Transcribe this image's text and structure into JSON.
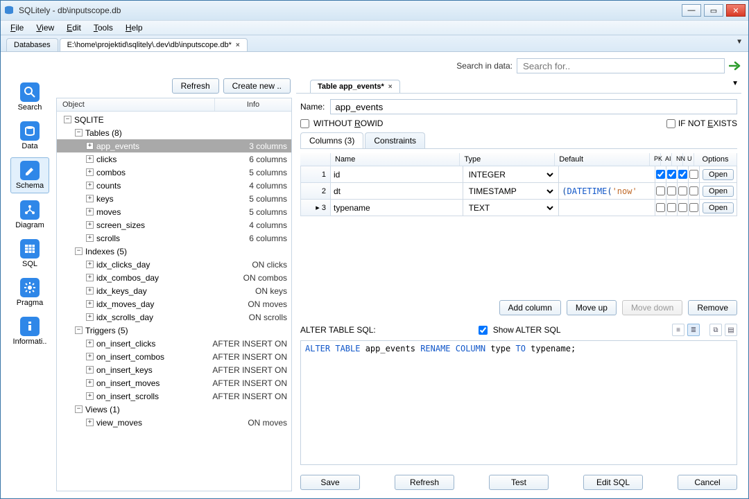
{
  "window": {
    "title": "SQLitely  -  db\\inputscope.db"
  },
  "menus": {
    "file": "File",
    "view": "View",
    "edit": "Edit",
    "tools": "Tools",
    "help": "Help"
  },
  "tabs": {
    "databases": "Databases",
    "file_path": "E:\\home\\projektid\\sqlitely\\.dev\\db\\inputscope.db*"
  },
  "search": {
    "label": "Search in data:",
    "placeholder": "Search for.."
  },
  "leftnav": {
    "search": "Search",
    "data": "Data",
    "schema": "Schema",
    "diagram": "Diagram",
    "sql": "SQL",
    "pragma": "Pragma",
    "info": "Informati.."
  },
  "mid_toolbar": {
    "refresh": "Refresh",
    "create": "Create new .."
  },
  "tree_header": {
    "object": "Object",
    "info": "Info"
  },
  "tree": {
    "root": "SQLITE",
    "tables_label": "Tables (8)",
    "tables": [
      {
        "name": "app_events",
        "info": "3 columns",
        "selected": true
      },
      {
        "name": "clicks",
        "info": "6 columns"
      },
      {
        "name": "combos",
        "info": "5 columns"
      },
      {
        "name": "counts",
        "info": "4 columns"
      },
      {
        "name": "keys",
        "info": "5 columns"
      },
      {
        "name": "moves",
        "info": "5 columns"
      },
      {
        "name": "screen_sizes",
        "info": "4 columns"
      },
      {
        "name": "scrolls",
        "info": "6 columns"
      }
    ],
    "indexes_label": "Indexes (5)",
    "indexes": [
      {
        "name": "idx_clicks_day",
        "info": "ON clicks"
      },
      {
        "name": "idx_combos_day",
        "info": "ON combos"
      },
      {
        "name": "idx_keys_day",
        "info": "ON keys"
      },
      {
        "name": "idx_moves_day",
        "info": "ON moves"
      },
      {
        "name": "idx_scrolls_day",
        "info": "ON scrolls"
      }
    ],
    "triggers_label": "Triggers (5)",
    "triggers": [
      {
        "name": "on_insert_clicks",
        "info": "AFTER INSERT ON"
      },
      {
        "name": "on_insert_combos",
        "info": "AFTER INSERT ON"
      },
      {
        "name": "on_insert_keys",
        "info": "AFTER INSERT ON"
      },
      {
        "name": "on_insert_moves",
        "info": "AFTER INSERT ON"
      },
      {
        "name": "on_insert_scrolls",
        "info": "AFTER INSERT ON"
      }
    ],
    "views_label": "Views (1)",
    "views": [
      {
        "name": "view_moves",
        "info": "ON moves"
      }
    ]
  },
  "editor": {
    "tab": "Table app_events*",
    "name_label": "Name:",
    "name_value": "app_events",
    "without_rowid": "WITHOUT ROWID",
    "if_not_exists": "IF NOT EXISTS",
    "subtab_columns": "Columns (3)",
    "subtab_constraints": "Constraints",
    "grid": {
      "h_name": "Name",
      "h_type": "Type",
      "h_default": "Default",
      "h_pk": "PK",
      "h_ai": "AI",
      "h_nn": "NN",
      "h_u": "U",
      "h_options": "Options",
      "rows": [
        {
          "n": "1",
          "name": "id",
          "type": "INTEGER",
          "def": "",
          "pk": true,
          "ai": true,
          "nn": true,
          "u": false
        },
        {
          "n": "2",
          "name": "dt",
          "type": "TIMESTAMP",
          "def_parts": [
            "(",
            "DATETIME",
            "(",
            "'now'"
          ],
          "pk": false,
          "ai": false,
          "nn": false,
          "u": false
        },
        {
          "n": "▸ 3",
          "name": "typename",
          "type": "TEXT",
          "def": "",
          "pk": false,
          "ai": false,
          "nn": false,
          "u": false
        }
      ],
      "open": "Open"
    },
    "buttons": {
      "add": "Add column",
      "up": "Move up",
      "down": "Move down",
      "remove": "Remove"
    },
    "sql_label": "ALTER TABLE SQL:",
    "show_alter": "Show ALTER SQL",
    "sql_parts": {
      "k1": "ALTER TABLE",
      "t1": " app_events ",
      "k2": "RENAME COLUMN",
      "t2": " type ",
      "k3": "TO",
      "t3": " typename;"
    },
    "footer": {
      "save": "Save",
      "refresh2": "Refresh",
      "test": "Test",
      "editsql": "Edit SQL",
      "cancel": "Cancel"
    }
  }
}
